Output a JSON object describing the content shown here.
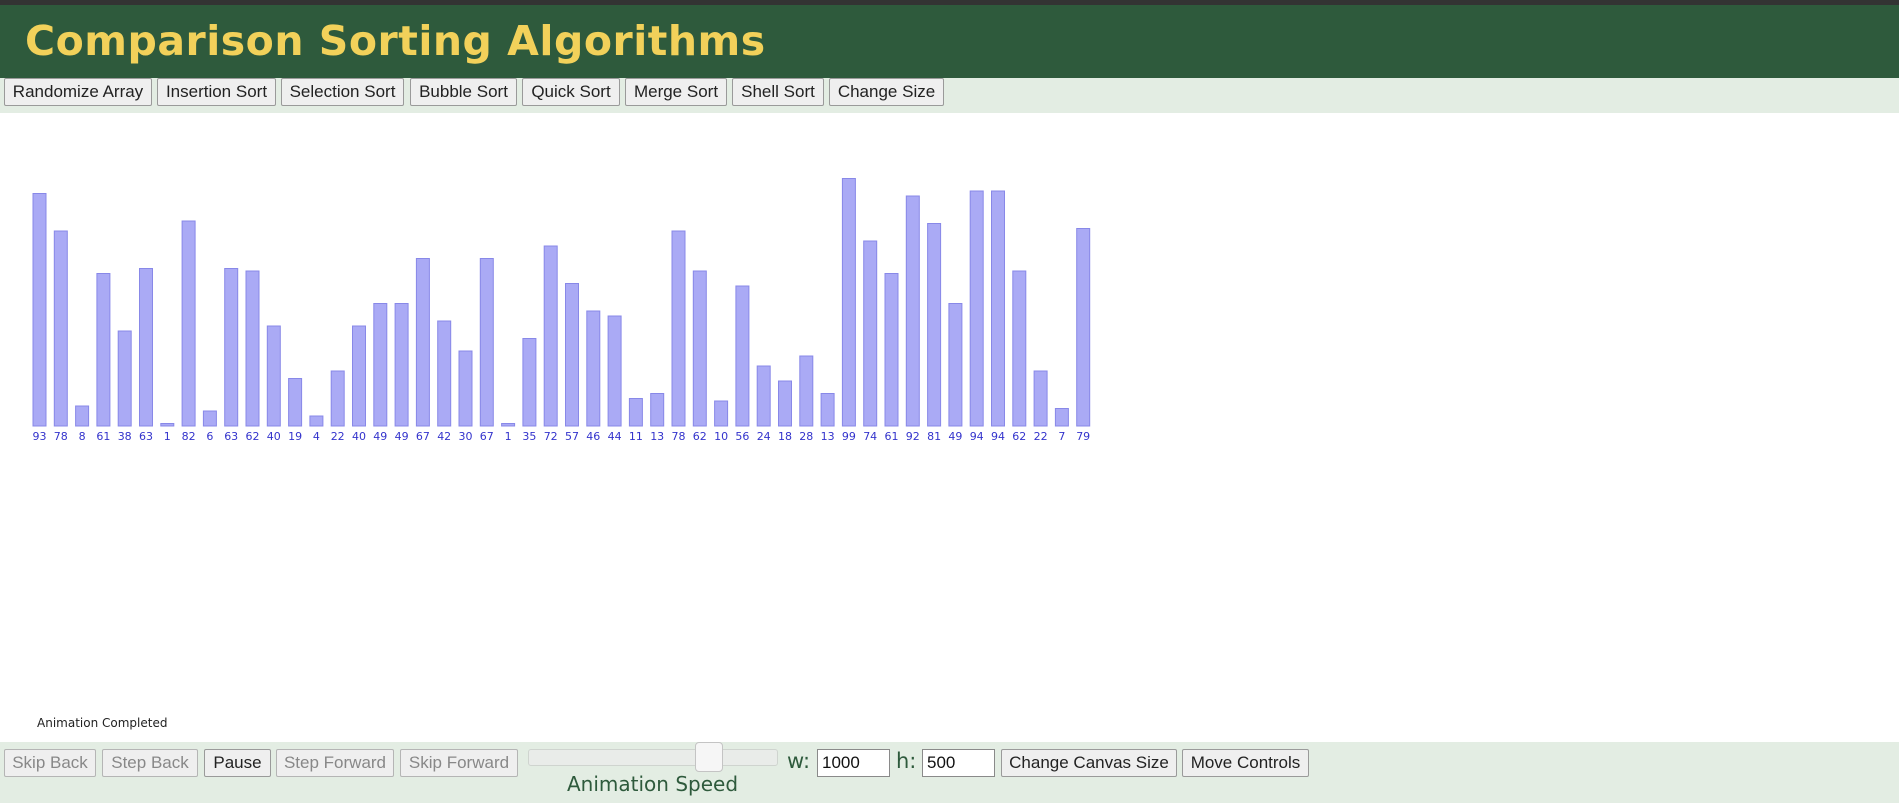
{
  "header": {
    "title": "Comparison Sorting Algorithms"
  },
  "toolbar": {
    "buttons": [
      "Randomize Array",
      "Insertion Sort",
      "Selection Sort",
      "Bubble Sort",
      "Quick Sort",
      "Merge Sort",
      "Shell Sort",
      "Change Size"
    ]
  },
  "array": {
    "values": [
      93,
      78,
      8,
      61,
      38,
      63,
      1,
      82,
      6,
      63,
      62,
      40,
      19,
      4,
      22,
      40,
      49,
      49,
      67,
      42,
      30,
      67,
      1,
      35,
      72,
      57,
      46,
      44,
      11,
      13,
      78,
      62,
      10,
      56,
      24,
      18,
      28,
      13,
      99,
      74,
      61,
      92,
      81,
      49,
      94,
      94,
      62,
      22,
      7,
      79
    ],
    "bar_fill": "#aaaaf5",
    "bar_stroke": "#8888e8",
    "label_color": "#3333cc"
  },
  "status": {
    "text": "Animation Completed"
  },
  "controls": {
    "skip_back": "Skip Back",
    "step_back": "Step Back",
    "pause": "Pause",
    "step_forward": "Step Forward",
    "skip_forward": "Skip Forward",
    "speed_label": "Animation Speed",
    "speed_fraction": 0.75,
    "width_label": "w:",
    "width_value": "1000",
    "height_label": "h:",
    "height_value": "500",
    "change_canvas": "Change Canvas Size",
    "move_controls": "Move Controls"
  },
  "colors": {
    "header_bg": "#2e5a3c",
    "title": "#f2d15a",
    "bar_bg": "#e3ede3"
  }
}
